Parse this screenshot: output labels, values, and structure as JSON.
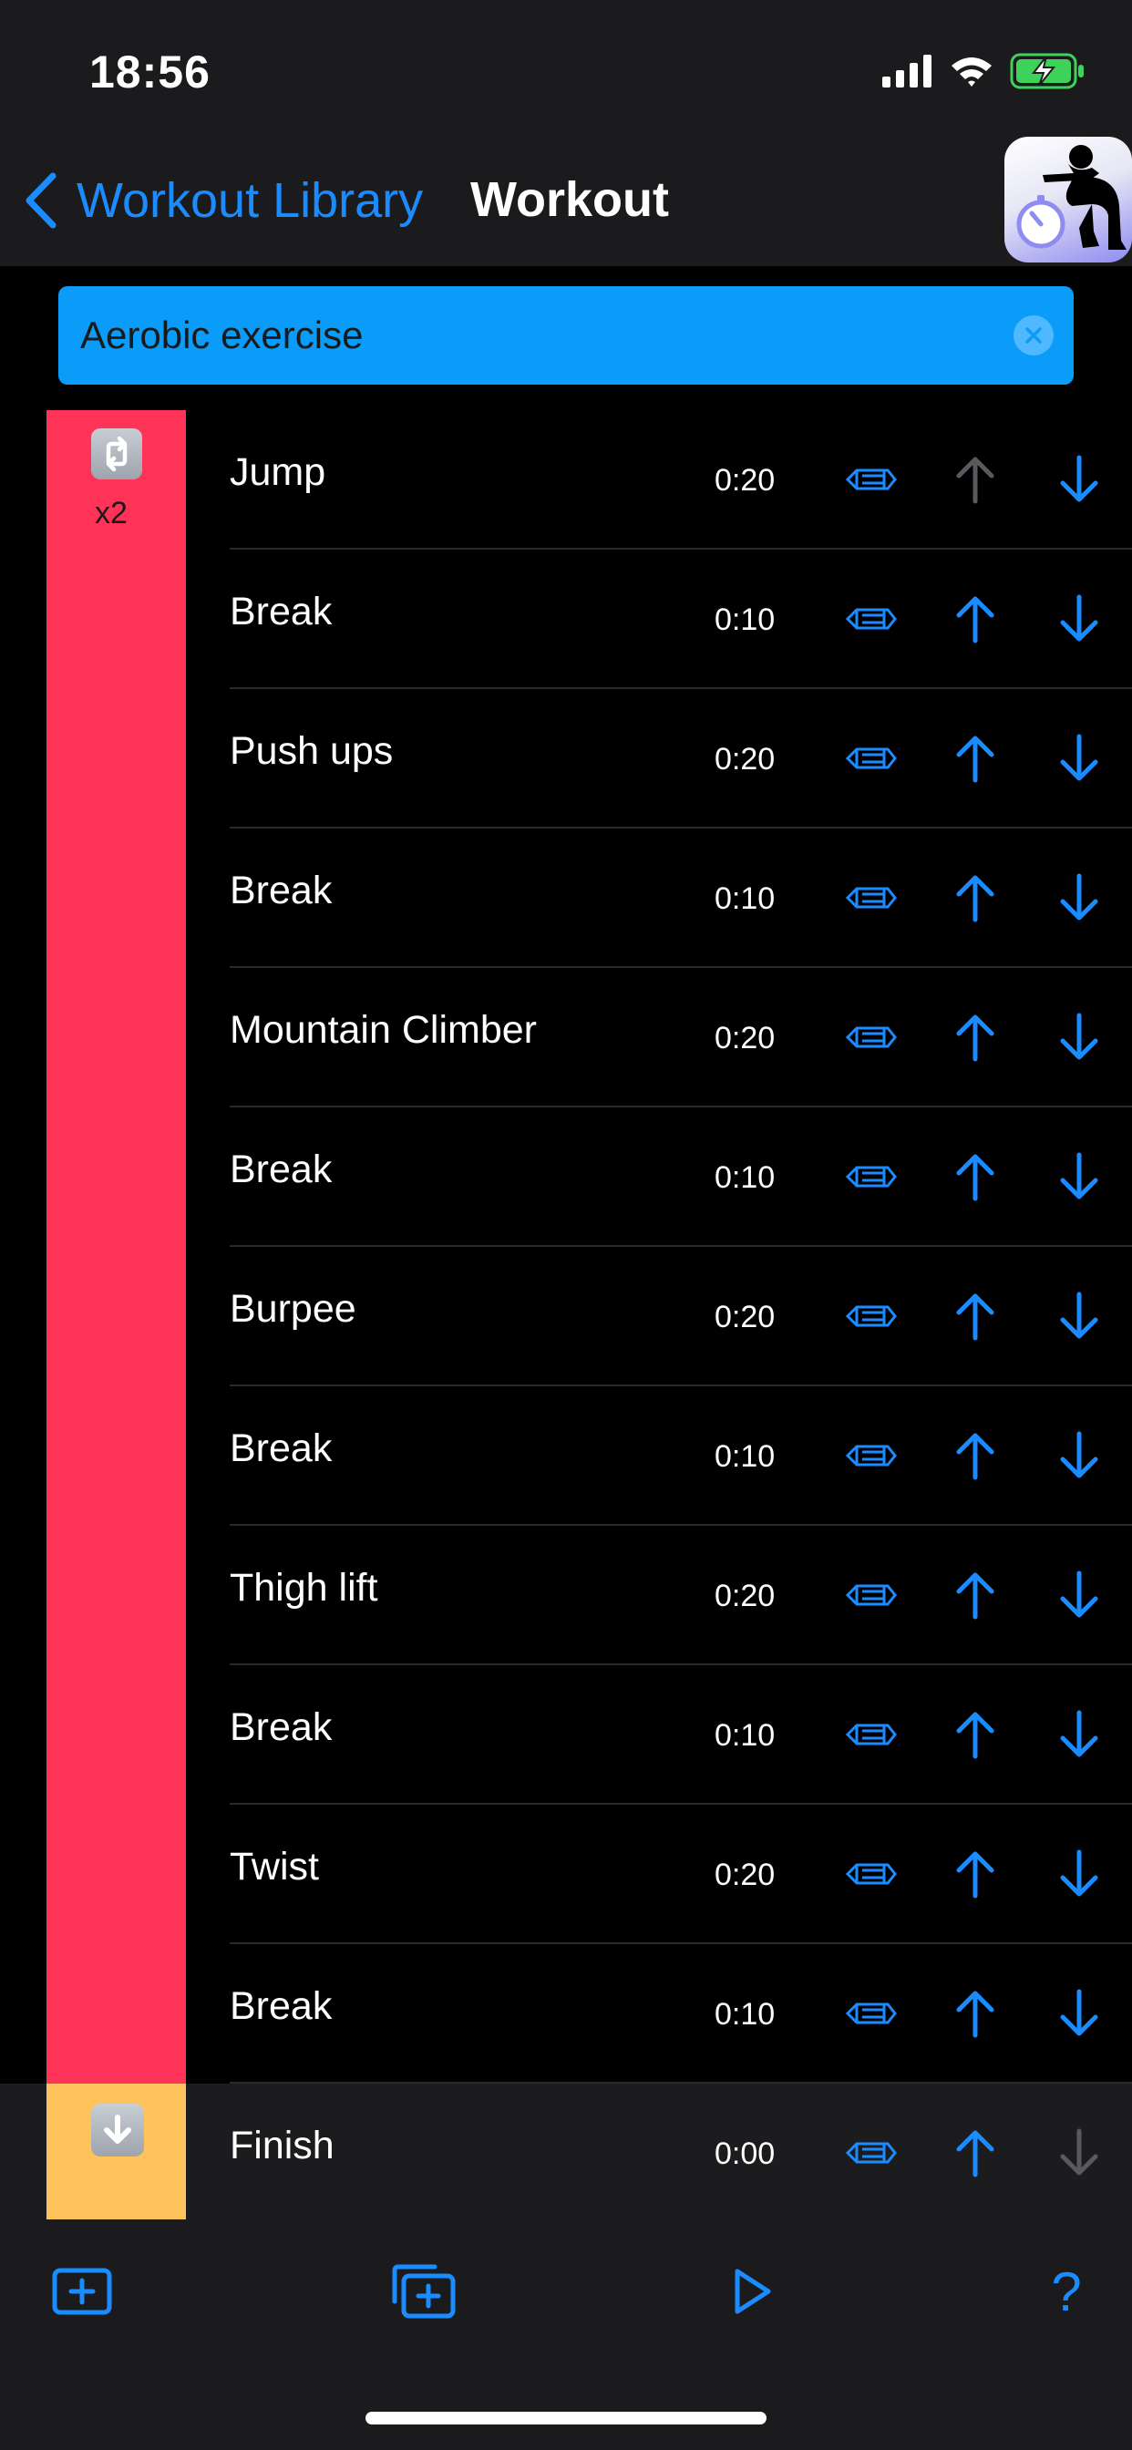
{
  "status_bar": {
    "time": "18:56"
  },
  "nav": {
    "back_label": "Workout Library",
    "title": "Workout"
  },
  "workout_name": {
    "value": "Aerobic exercise"
  },
  "group": {
    "repeat_count": "x2",
    "color": "#ff3358",
    "repeat_icon": "repeat-arrows-icon"
  },
  "finish_group": {
    "color": "#ffc35c",
    "icon": "down-arrow-badge-icon"
  },
  "rows": [
    {
      "name": "Jump",
      "time": "0:20",
      "up_enabled": false,
      "down_enabled": true
    },
    {
      "name": "Break",
      "time": "0:10",
      "up_enabled": true,
      "down_enabled": true
    },
    {
      "name": "Push ups",
      "time": "0:20",
      "up_enabled": true,
      "down_enabled": true
    },
    {
      "name": "Break",
      "time": "0:10",
      "up_enabled": true,
      "down_enabled": true
    },
    {
      "name": "Mountain Climber",
      "time": "0:20",
      "up_enabled": true,
      "down_enabled": true
    },
    {
      "name": "Break",
      "time": "0:10",
      "up_enabled": true,
      "down_enabled": true
    },
    {
      "name": "Burpee",
      "time": "0:20",
      "up_enabled": true,
      "down_enabled": true
    },
    {
      "name": "Break",
      "time": "0:10",
      "up_enabled": true,
      "down_enabled": true
    },
    {
      "name": "Thigh lift",
      "time": "0:20",
      "up_enabled": true,
      "down_enabled": true
    },
    {
      "name": "Break",
      "time": "0:10",
      "up_enabled": true,
      "down_enabled": true
    },
    {
      "name": "Twist",
      "time": "0:20",
      "up_enabled": true,
      "down_enabled": true
    },
    {
      "name": "Break",
      "time": "0:10",
      "up_enabled": true,
      "down_enabled": true
    },
    {
      "name": "Finish",
      "time": "0:00",
      "up_enabled": true,
      "down_enabled": false
    }
  ],
  "toolbar": {
    "add_icon": "add-square-icon",
    "add_group_icon": "add-group-icon",
    "play_icon": "play-icon",
    "help_icon": "question-mark-icon",
    "help_label": "?"
  },
  "colors": {
    "accent": "#1a8cff",
    "disabled": "#5a5a5e",
    "field": "#0a9cf8"
  }
}
